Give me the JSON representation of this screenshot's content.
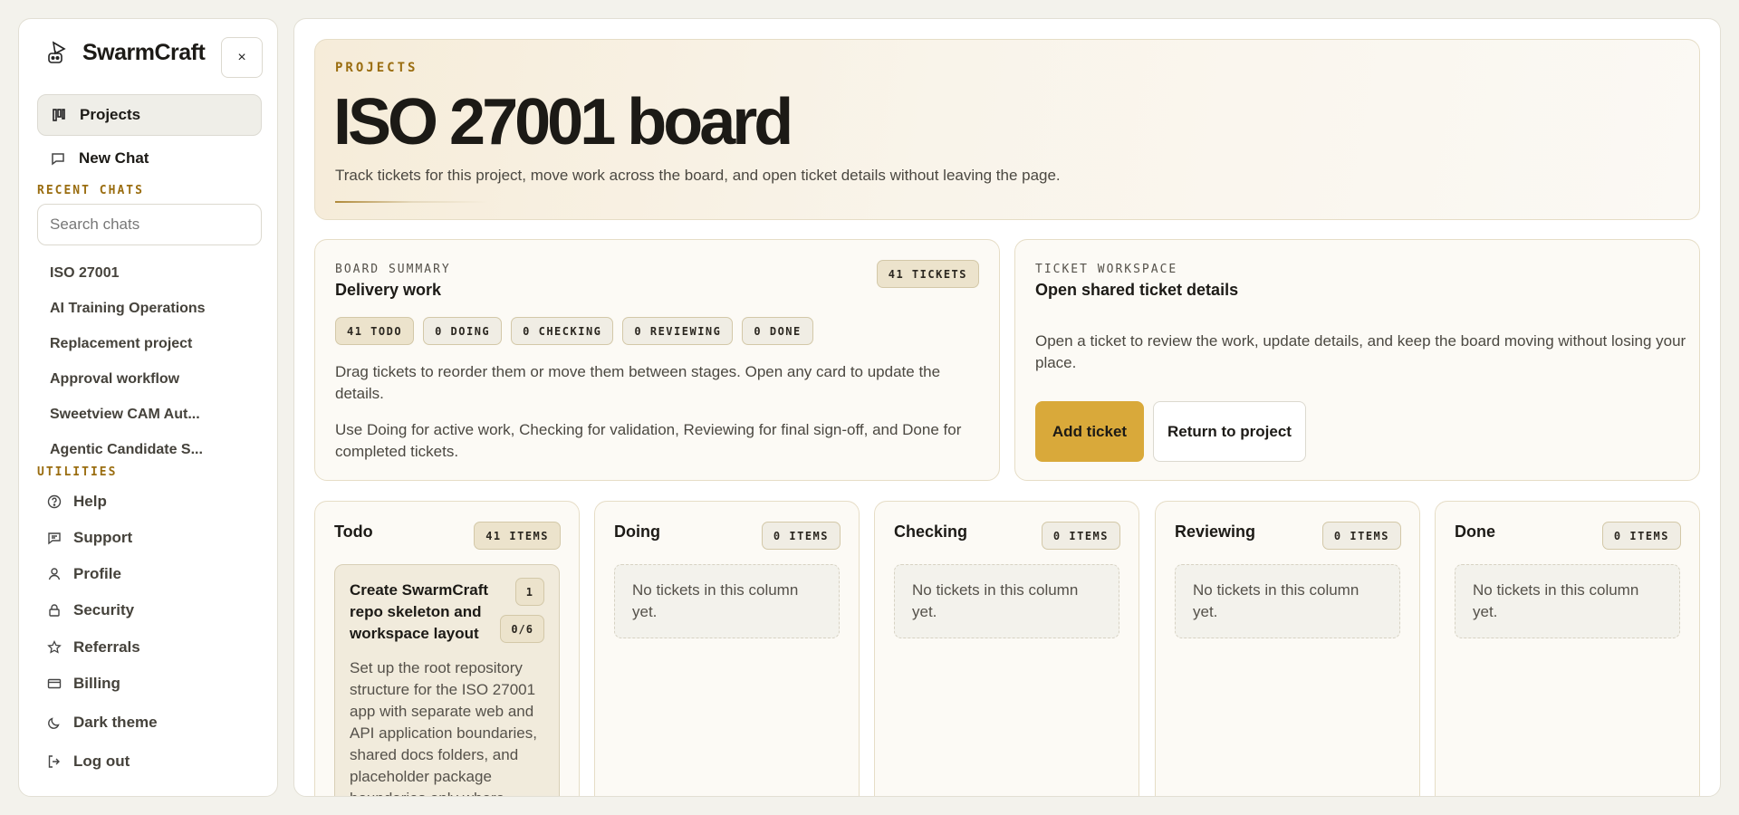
{
  "sidebar": {
    "brand": "SwarmCraft",
    "close_label": "×",
    "nav": [
      {
        "label": "Projects",
        "icon": "kanban-icon"
      },
      {
        "label": "New Chat",
        "icon": "chat-bubble-icon"
      }
    ],
    "recent_label": "RECENT CHATS",
    "search_placeholder": "Search chats",
    "chats": [
      "ISO 27001",
      "AI Training Operations",
      "Replacement project",
      "Approval workflow",
      "Sweetview CAM Aut...",
      "Agentic Candidate S..."
    ],
    "utilities_label": "UTILITIES",
    "utilities": [
      {
        "label": "Help",
        "icon": "help-icon"
      },
      {
        "label": "Support",
        "icon": "support-icon"
      },
      {
        "label": "Profile",
        "icon": "user-icon"
      },
      {
        "label": "Security",
        "icon": "lock-icon"
      },
      {
        "label": "Referrals",
        "icon": "star-icon"
      },
      {
        "label": "Billing",
        "icon": "card-icon"
      },
      {
        "label": "Dark theme",
        "icon": "moon-icon"
      },
      {
        "label": "Log out",
        "icon": "logout-icon"
      }
    ]
  },
  "hero": {
    "kicker": "PROJECTS",
    "title": "ISO 27001 board",
    "description": "Track tickets for this project, move work across the board, and open ticket details without leaving the page."
  },
  "summary": {
    "kicker": "BOARD SUMMARY",
    "title": "Delivery work",
    "total_chip": "41 TICKETS",
    "chips": [
      "41 TODO",
      "0 DOING",
      "0 CHECKING",
      "0 REVIEWING",
      "0 DONE"
    ],
    "text1": "Drag tickets to reorder them or move them between stages. Open any card to update the details.",
    "text2": "Use Doing for active work, Checking for validation, Reviewing for final sign-off, and Done for completed tickets."
  },
  "workspace": {
    "kicker": "TICKET WORKSPACE",
    "title": "Open shared ticket details",
    "text": "Open a ticket to review the work, update details, and keep the board moving without losing your place.",
    "add_label": "Add ticket",
    "return_label": "Return to project"
  },
  "columns": [
    {
      "name": "Todo",
      "count": "41 ITEMS"
    },
    {
      "name": "Doing",
      "count": "0 ITEMS",
      "empty": "No tickets in this column yet."
    },
    {
      "name": "Checking",
      "count": "0 ITEMS",
      "empty": "No tickets in this column yet."
    },
    {
      "name": "Reviewing",
      "count": "0 ITEMS",
      "empty": "No tickets in this column yet."
    },
    {
      "name": "Done",
      "count": "0 ITEMS",
      "empty": "No tickets in this column yet."
    }
  ],
  "ticket": {
    "title": "Create SwarmCraft repo skeleton and workspace layout",
    "number": "1",
    "progress": "0/6",
    "description": "Set up the root repository structure for the ISO 27001 app with separate web and API application boundaries, shared docs folders, and placeholder package boundaries only where"
  },
  "colors": {
    "accent": "#d9a93a",
    "kicker": "#9a6d10",
    "background": "#f3f2ec"
  }
}
